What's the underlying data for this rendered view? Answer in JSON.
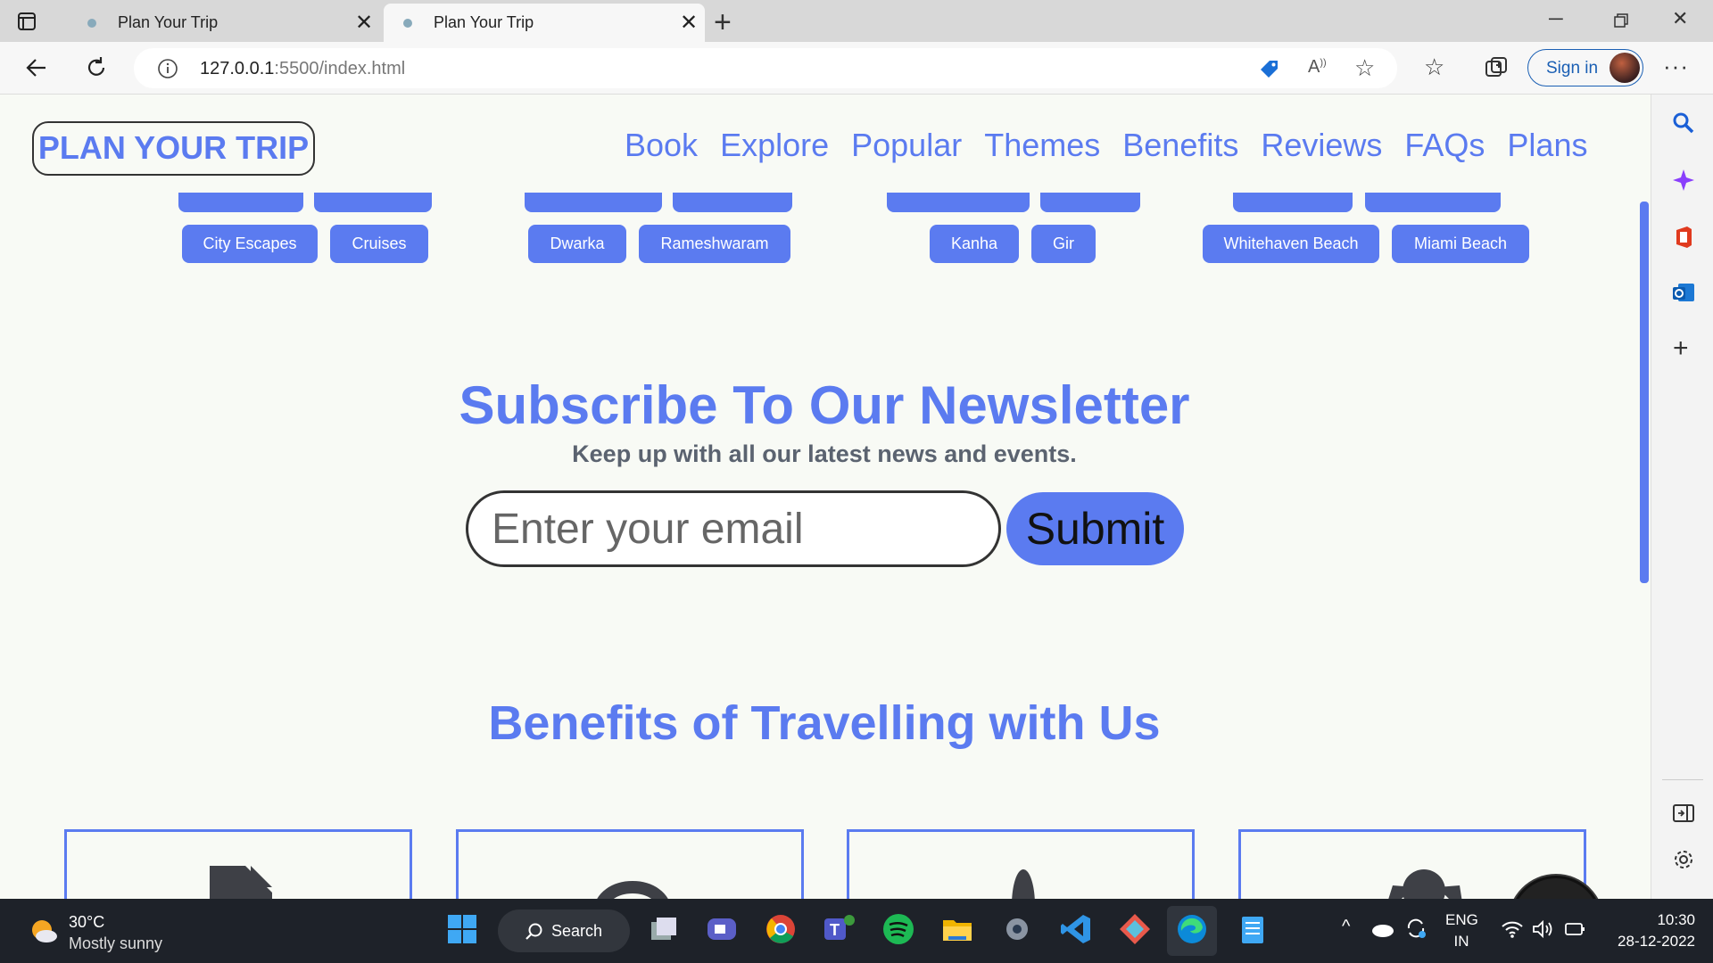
{
  "browser": {
    "tabs": [
      {
        "title": "Plan Your Trip",
        "active": false
      },
      {
        "title": "Plan Your Trip",
        "active": true
      }
    ],
    "url_host": "127.0.0.1",
    "url_rest": ":5500/index.html",
    "signin_label": "Sign in"
  },
  "site": {
    "logo": "PLAN YOUR TRIP",
    "nav": [
      "Book",
      "Explore",
      "Popular",
      "Themes",
      "Benefits",
      "Reviews",
      "FAQs",
      "Plans"
    ],
    "chips": {
      "group1": [
        "City Escapes",
        "Cruises"
      ],
      "group2": [
        "Dwarka",
        "Rameshwaram"
      ],
      "group3": [
        "Kanha",
        "Gir"
      ],
      "group4": [
        "Whitehaven Beach",
        "Miami Beach"
      ]
    },
    "newsletter": {
      "title": "Subscribe To Our Newsletter",
      "subtitle": "Keep up with all our latest news and events.",
      "email_placeholder": "Enter your email",
      "submit_label": "Submit"
    },
    "benefits_title": "Benefits of Travelling with Us"
  },
  "taskbar": {
    "weather_temp": "30°C",
    "weather_desc": "Mostly sunny",
    "search_label": "Search",
    "lang_1": "ENG",
    "lang_2": "IN",
    "time": "10:30",
    "date": "28-12-2022"
  },
  "colors": {
    "accent": "#5b7bf0",
    "taskbar": "#1e2229"
  }
}
